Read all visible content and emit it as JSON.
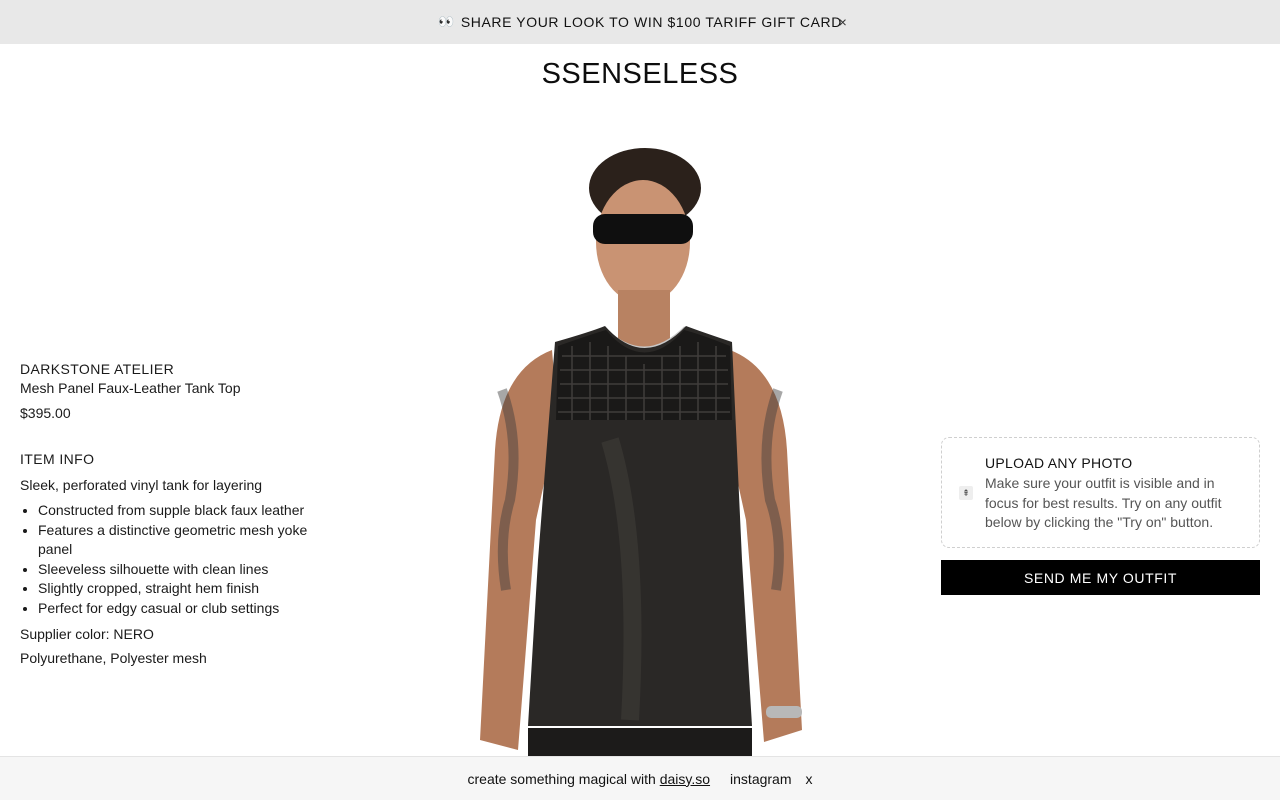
{
  "announcement": {
    "icon": "eyes-emoji",
    "emoji": "👀",
    "text": "SHARE YOUR LOOK TO WIN $100 TARIFF GIFT CARD",
    "close_label": "×"
  },
  "header": {
    "logo": "SSENSELESS"
  },
  "product": {
    "brand": "DARKSTONE ATELIER",
    "name": "Mesh Panel Faux-Leather Tank Top",
    "price": "$395.00",
    "info_title": "ITEM INFO",
    "summary": "Sleek, perforated vinyl tank for layering",
    "bullets": [
      "Constructed from supple black faux leather",
      "Features a distinctive geometric mesh yoke panel",
      "Sleeveless silhouette with clean lines",
      "Slightly cropped, straight hem finish",
      "Perfect for edgy casual or club settings"
    ],
    "supplier_color": "Supplier color: NERO",
    "materials": "Polyurethane, Polyester mesh"
  },
  "upload": {
    "icon": "upload-icon",
    "icon_glyph": "⇞",
    "title": "UPLOAD ANY PHOTO",
    "description": "Make sure your outfit is visible and in focus for best results. Try on any outfit below by clicking the \"Try on\" button."
  },
  "cta": {
    "label": "SEND ME MY OUTFIT"
  },
  "footer": {
    "prefix": "create something magical with",
    "link": "daisy.so",
    "instagram": "instagram",
    "close": "x"
  },
  "colors": {
    "announcement_bg": "#e8e8e8",
    "button_bg": "#000000",
    "button_text": "#ffffff",
    "footer_bg": "#f6f6f6"
  }
}
